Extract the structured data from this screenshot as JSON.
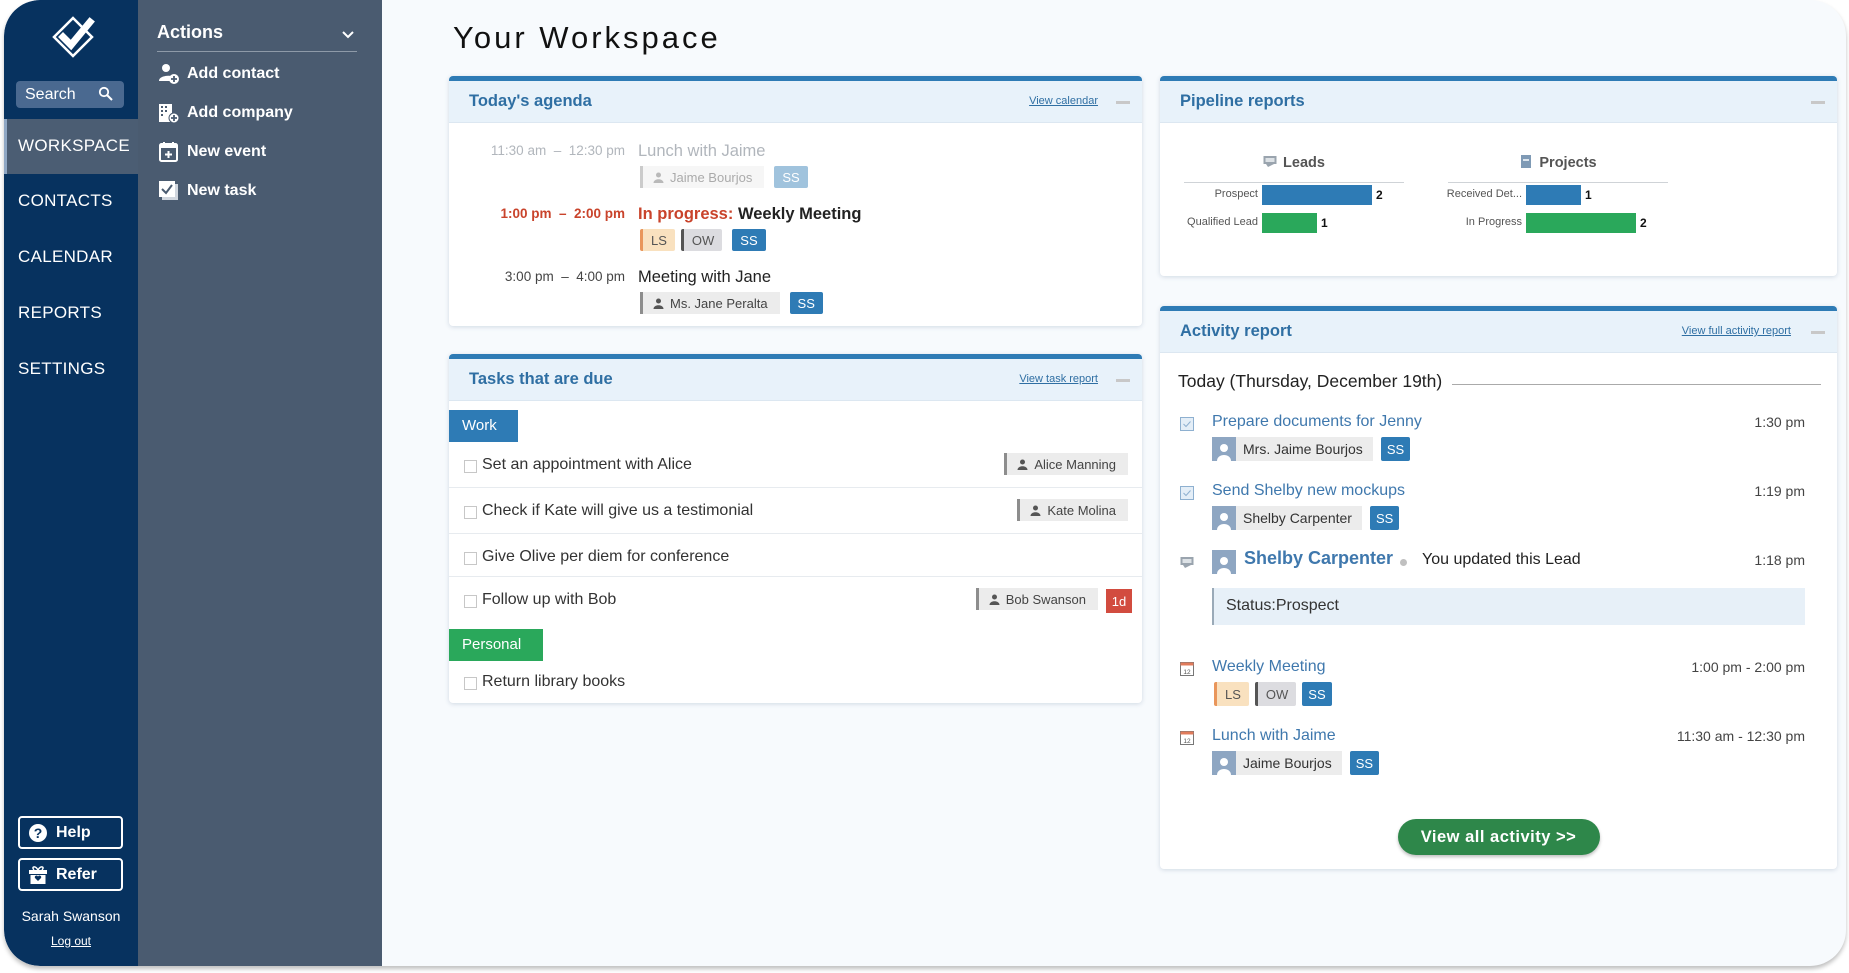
{
  "sidebar": {
    "search_label": "Search",
    "nav": [
      {
        "label": "WORKSPACE",
        "active": true
      },
      {
        "label": "CONTACTS"
      },
      {
        "label": "CALENDAR"
      },
      {
        "label": "REPORTS"
      },
      {
        "label": "SETTINGS"
      }
    ],
    "help_label": "Help",
    "refer_label": "Refer",
    "user_name": "Sarah Swanson",
    "logout_label": "Log out"
  },
  "actions": {
    "title": "Actions",
    "items": [
      {
        "label": "Add contact",
        "icon": "add-contact-icon"
      },
      {
        "label": "Add company",
        "icon": "add-company-icon"
      },
      {
        "label": "New event",
        "icon": "new-event-icon"
      },
      {
        "label": "New task",
        "icon": "new-task-icon"
      }
    ]
  },
  "page": {
    "title": "Your Workspace"
  },
  "agenda": {
    "title": "Today's agenda",
    "link": "View calendar",
    "events": [
      {
        "time": "11:30 am  –  12:30 pm",
        "title": "Lunch with Jaime",
        "state": "past",
        "contact": "Jaime Bourjos",
        "tags": [
          "SS"
        ]
      },
      {
        "time": "1:00 pm  –  2:00 pm",
        "status": "In progress:",
        "title": "Weekly Meeting",
        "state": "now",
        "tags": [
          "LS",
          "OW",
          "SS"
        ]
      },
      {
        "time": "3:00 pm  –  4:00 pm",
        "title": "Meeting with Jane",
        "state": "future",
        "contact": "Ms. Jane Peralta",
        "tags": [
          "SS"
        ]
      }
    ]
  },
  "tasks": {
    "title": "Tasks that are due",
    "link": "View task report",
    "groups": [
      {
        "name": "Work",
        "color": "#2e7bb5",
        "items": [
          {
            "title": "Set an appointment with Alice",
            "assignee": "Alice Manning"
          },
          {
            "title": "Check if Kate will give us a testimonial",
            "assignee": "Kate Molina"
          },
          {
            "title": "Give Olive per diem for conference"
          },
          {
            "title": "Follow up with Bob",
            "assignee": "Bob Swanson",
            "overdue": "1d"
          }
        ]
      },
      {
        "name": "Personal",
        "color": "#2aa85b",
        "items": [
          {
            "title": "Return library books"
          }
        ]
      }
    ]
  },
  "pipeline": {
    "title": "Pipeline reports",
    "colors": {
      "primary": "#2e7bb5",
      "secondary": "#2aa85b"
    },
    "chart_data": [
      {
        "type": "bar",
        "title": "Leads",
        "categories": [
          "Prospect",
          "Qualified Lead"
        ],
        "values": [
          2,
          1
        ]
      },
      {
        "type": "bar",
        "title": "Projects",
        "categories": [
          "Received Det...",
          "In Progress"
        ],
        "values": [
          1,
          2
        ]
      }
    ]
  },
  "activity": {
    "title": "Activity report",
    "link": "View full activity report",
    "day_heading": "Today (Thursday, December 19th)",
    "items": [
      {
        "kind": "task",
        "title": "Prepare documents for Jenny",
        "time": "1:30 pm",
        "contact": "Mrs. Jaime Bourjos",
        "tags": [
          "SS"
        ]
      },
      {
        "kind": "task",
        "title": "Send Shelby new mockups",
        "time": "1:19 pm",
        "contact": "Shelby Carpenter",
        "tags": [
          "SS"
        ]
      },
      {
        "kind": "lead",
        "name": "Shelby Carpenter",
        "text": "You updated this Lead",
        "time": "1:18 pm",
        "status_label": "Status:",
        "status_value": "Prospect"
      },
      {
        "kind": "event",
        "title": "Weekly Meeting",
        "time": "1:00 pm - 2:00 pm",
        "tags": [
          "LS",
          "OW",
          "SS"
        ]
      },
      {
        "kind": "event",
        "title": "Lunch with Jaime",
        "time": "11:30 am - 12:30 pm",
        "contact": "Jaime Bourjos",
        "tags": [
          "SS"
        ]
      }
    ],
    "view_all_label": "View all activity >>"
  }
}
